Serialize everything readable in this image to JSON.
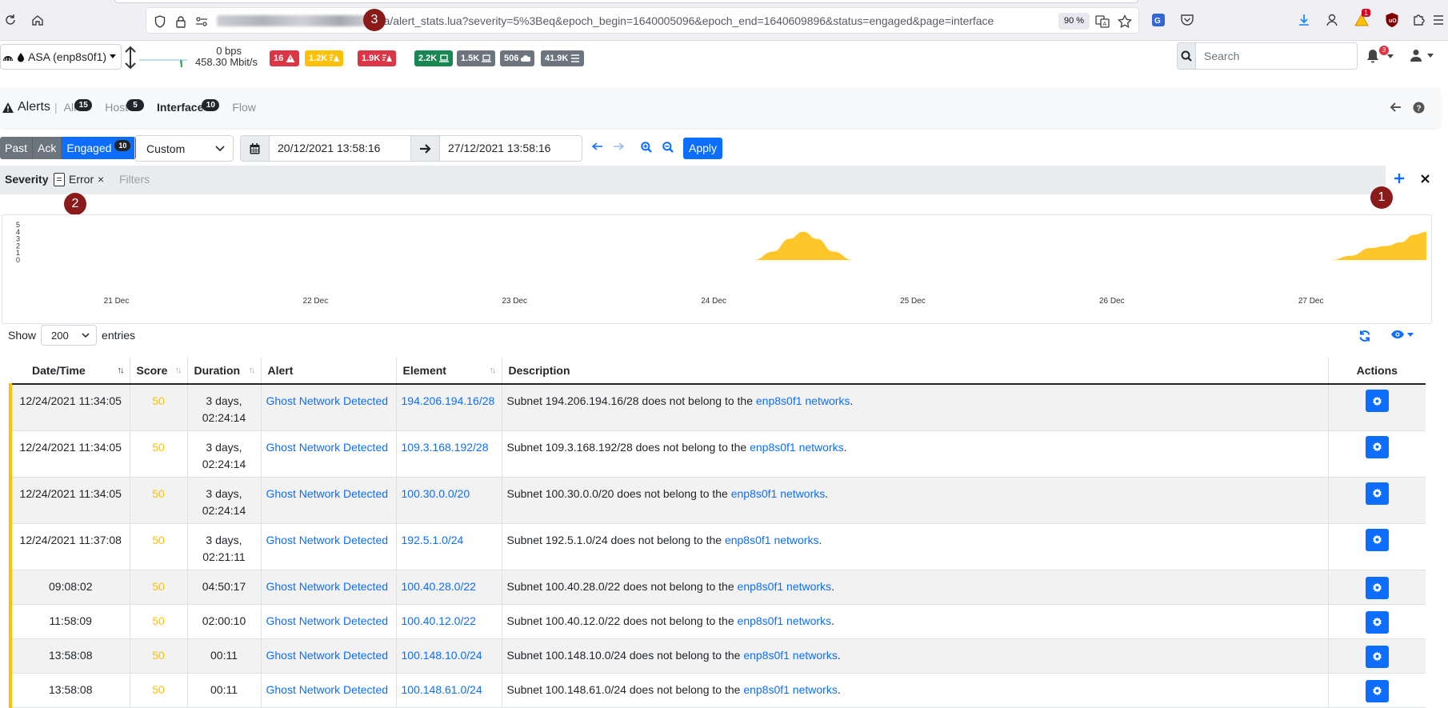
{
  "browser": {
    "url": "/lua/alert_stats.lua?severity=5%3Beq&epoch_begin=1640005096&epoch_end=1640609896&status=engaged&page=interface",
    "zoom": "90 %",
    "notification_count": "1"
  },
  "markers": [
    "1",
    "2",
    "3"
  ],
  "navbar": {
    "interface": "ASA (enp8s0f1)",
    "bps_out": "0 bps",
    "bps_in": "458.30 Mbit/s",
    "badges": [
      {
        "label": "16",
        "color": "#dc3545",
        "icon": "warning-icon"
      },
      {
        "label": "1.2K",
        "color": "#ffc107",
        "icon": "list-warning-icon"
      },
      {
        "label": "1.9K",
        "color": "#dc3545",
        "icon": "list-warning-icon"
      },
      {
        "label": "2.2K",
        "color": "#198754",
        "icon": "laptop-icon"
      },
      {
        "label": "1.5K",
        "color": "#6c757d",
        "icon": "laptop-icon"
      },
      {
        "label": "506",
        "color": "#6c757d",
        "icon": "cloud-icon"
      },
      {
        "label": "41.9K",
        "color": "#6c757d",
        "icon": "list-icon"
      }
    ],
    "search_placeholder": "Search",
    "bell_count": "3"
  },
  "alerts_header": {
    "title": "Alerts",
    "tabs": [
      {
        "label": "All",
        "count": "15"
      },
      {
        "label": "Host",
        "count": "5"
      },
      {
        "label": "Interface",
        "count": "10"
      },
      {
        "label": "Flow",
        "count": ""
      }
    ]
  },
  "filters": {
    "status_tabs": [
      {
        "label": "Past"
      },
      {
        "label": "Ack"
      },
      {
        "label": "Engaged",
        "count": "10"
      }
    ],
    "range": "Custom",
    "date_begin": "20/12/2021 13:58:16",
    "date_end": "27/12/2021 13:58:16",
    "apply_label": "Apply",
    "tag": {
      "key": "Severity",
      "op": "=",
      "value": "Error",
      "remove": "×"
    },
    "tags_placeholder": "Filters"
  },
  "chart_data": {
    "type": "area",
    "color": "#ffc629",
    "x_labels": [
      "21 Dec",
      "22 Dec",
      "23 Dec",
      "24 Dec",
      "25 Dec",
      "26 Dec",
      "27 Dec"
    ],
    "y_ticks": [
      "0",
      "1",
      "2",
      "3",
      "4",
      "5"
    ],
    "ylim": [
      0,
      5
    ],
    "x_range_days": [
      20.58,
      27.58
    ],
    "points": [
      [
        20.58,
        0
      ],
      [
        24.2,
        0
      ],
      [
        24.3,
        1.2
      ],
      [
        24.38,
        3.0
      ],
      [
        24.45,
        4.0
      ],
      [
        24.52,
        3.0
      ],
      [
        24.6,
        1.2
      ],
      [
        24.7,
        0
      ],
      [
        27.1,
        0
      ],
      [
        27.2,
        0.6
      ],
      [
        27.3,
        1.7
      ],
      [
        27.38,
        2.0
      ],
      [
        27.45,
        2.5
      ],
      [
        27.52,
        3.6
      ],
      [
        27.58,
        4.0
      ]
    ],
    "grid": false
  },
  "table": {
    "show_label": "Show",
    "entries_label": "entries",
    "page_length": "200",
    "columns": [
      "Date/Time",
      "Score",
      "Duration",
      "Alert",
      "Element",
      "Description",
      "Actions"
    ],
    "rows": [
      {
        "datetime": "12/24/2021 11:34:05",
        "score": "50",
        "duration": "3 days, 02:24:14",
        "alert": "Ghost Network Detected",
        "element": "194.206.194.16/28",
        "desc_pre": "Subnet 194.206.194.16/28 does not belong to the ",
        "desc_link": "enp8s0f1 networks",
        "desc_post": "."
      },
      {
        "datetime": "12/24/2021 11:34:05",
        "score": "50",
        "duration": "3 days, 02:24:14",
        "alert": "Ghost Network Detected",
        "element": "109.3.168.192/28",
        "desc_pre": "Subnet 109.3.168.192/28 does not belong to the ",
        "desc_link": "enp8s0f1 networks",
        "desc_post": "."
      },
      {
        "datetime": "12/24/2021 11:34:05",
        "score": "50",
        "duration": "3 days, 02:24:14",
        "alert": "Ghost Network Detected",
        "element": "100.30.0.0/20",
        "desc_pre": "Subnet 100.30.0.0/20 does not belong to the ",
        "desc_link": "enp8s0f1 networks",
        "desc_post": "."
      },
      {
        "datetime": "12/24/2021 11:37:08",
        "score": "50",
        "duration": "3 days, 02:21:11",
        "alert": "Ghost Network Detected",
        "element": "192.5.1.0/24",
        "desc_pre": "Subnet 192.5.1.0/24 does not belong to the ",
        "desc_link": "enp8s0f1 networks",
        "desc_post": "."
      },
      {
        "datetime": "09:08:02",
        "score": "50",
        "duration": "04:50:17",
        "alert": "Ghost Network Detected",
        "element": "100.40.28.0/22",
        "desc_pre": "Subnet 100.40.28.0/22 does not belong to the ",
        "desc_link": "enp8s0f1 networks",
        "desc_post": "."
      },
      {
        "datetime": "11:58:09",
        "score": "50",
        "duration": "02:00:10",
        "alert": "Ghost Network Detected",
        "element": "100.40.12.0/22",
        "desc_pre": "Subnet 100.40.12.0/22 does not belong to the ",
        "desc_link": "enp8s0f1 networks",
        "desc_post": "."
      },
      {
        "datetime": "13:58:08",
        "score": "50",
        "duration": "00:11",
        "alert": "Ghost Network Detected",
        "element": "100.148.10.0/24",
        "desc_pre": "Subnet 100.148.10.0/24 does not belong to the ",
        "desc_link": "enp8s0f1 networks",
        "desc_post": "."
      },
      {
        "datetime": "13:58:08",
        "score": "50",
        "duration": "00:11",
        "alert": "Ghost Network Detected",
        "element": "100.148.61.0/24",
        "desc_pre": "Subnet 100.148.61.0/24 does not belong to the ",
        "desc_link": "enp8s0f1 networks",
        "desc_post": "."
      }
    ]
  }
}
